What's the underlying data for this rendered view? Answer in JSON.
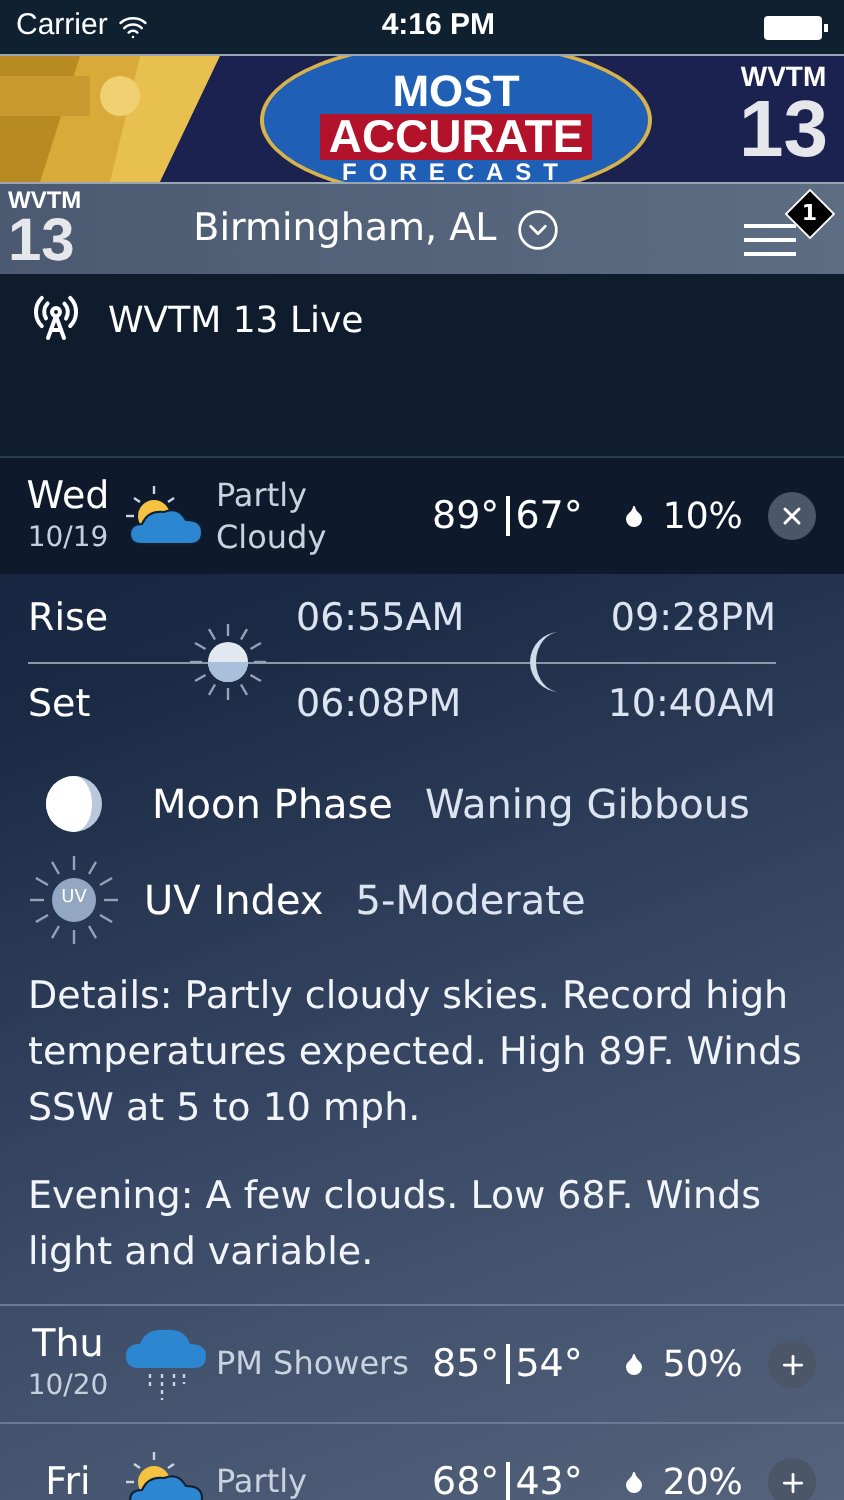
{
  "status_bar": {
    "carrier": "Carrier",
    "time": "4:16 PM"
  },
  "banner": {
    "headline_1": "MOST",
    "headline_2": "ACCURATE",
    "headline_3": "FORECAST",
    "station": "WVTM",
    "channel": "13"
  },
  "header": {
    "logo_station": "WVTM",
    "logo_channel": "13",
    "location": "Birmingham, AL",
    "badge": "1"
  },
  "live": {
    "label": "WVTM 13 Live"
  },
  "days": [
    {
      "day": "Wed",
      "date": "10/19",
      "kind": "partly",
      "conditions": [
        "Partly",
        "Cloudy"
      ],
      "high": "89°",
      "low": "67°",
      "precip": "10%",
      "expanded": true,
      "details": {
        "rise_label": "Rise",
        "set_label": "Set",
        "sunrise": "06:55AM",
        "sunset": "06:08PM",
        "moonrise": "09:28PM",
        "moonset": "10:40AM",
        "moon_phase_label": "Moon Phase",
        "moon_phase": "Waning Gibbous",
        "uv_label": "UV Index",
        "uv_icon_text": "UV",
        "uv": "5-Moderate",
        "paragraphs": [
          "Details: Partly cloudy skies. Record high temperatures expected. High 89F. Winds SSW at 5 to 10 mph.",
          "Evening: A few clouds. Low 68F. Winds light and variable."
        ]
      }
    },
    {
      "day": "Thu",
      "date": "10/20",
      "kind": "rain",
      "conditions": [
        "PM Showers"
      ],
      "high": "85°",
      "low": "54°",
      "precip": "50%",
      "expanded": false
    },
    {
      "day": "Fri",
      "kind": "partly",
      "conditions": [
        "Partly"
      ],
      "high": "68°",
      "low": "43°",
      "precip": "20%",
      "expanded": false
    }
  ]
}
